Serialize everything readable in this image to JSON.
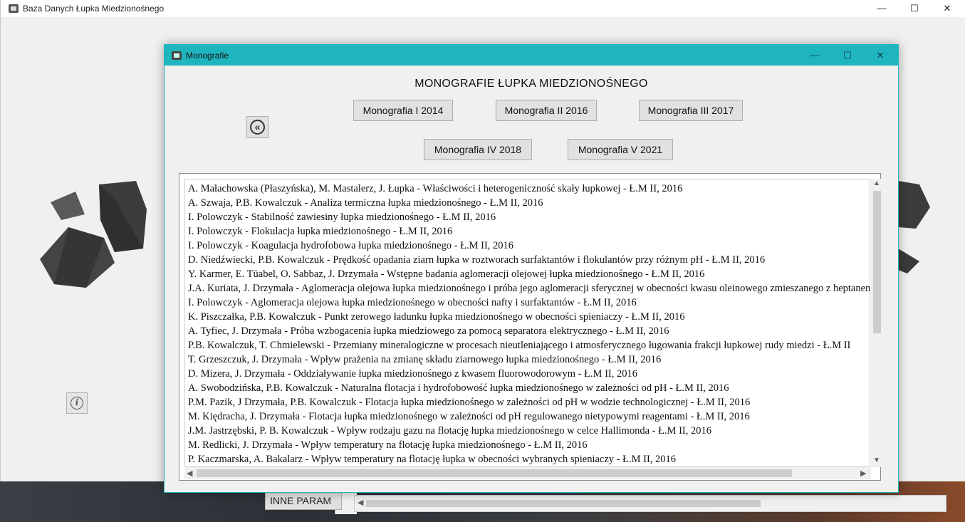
{
  "main_window": {
    "title": "Baza Danych Łupka Miedzionośnego",
    "minimize": "—",
    "maximize": "☐",
    "close": "✕",
    "inne_button_label": "INNE PARAM"
  },
  "dialog": {
    "title": "Monografie",
    "minimize": "—",
    "maximize": "☐",
    "close": "✕",
    "heading": "MONOGRAFIE ŁUPKA MIEDZIONOŚNEGO",
    "back_button_icon": "«",
    "info_icon": "i",
    "buttons": [
      "Monografia I 2014",
      "Monografia II 2016",
      "Monografia III 2017",
      "Monografia IV 2018",
      "Monografia V 2021"
    ],
    "list_items": [
      "A. Małachowska (Płaszyńska), M. Mastalerz, J. Łupka - Właściwości i heterogeniczność skały łupkowej - Ł.M II, 2016",
      "A. Szwaja, P.B. Kowalczuk - Analiza termiczna łupka miedzionośnego - Ł.M II, 2016",
      "I. Polowczyk - Stabilność zawiesiny łupka miedzionośnego - Ł.M II, 2016",
      "I. Polowczyk - Flokulacja łupka miedzionośnego - Ł.M II, 2016",
      "I. Polowczyk - Koagulacja hydrofobowa łupka miedzionośnego - Ł.M II, 2016",
      "D. Niedźwiecki, P.B. Kowalczuk - Prędkość opadania ziarn łupka w roztworach surfaktantów i flokulantów przy różnym pH - Ł.M II, 2016",
      "Y. Karmer, E. Tüabel, O. Sabbaz, J. Drzymała - Wstępne badania aglomeracji olejowej łupka miedzionośnego - Ł.M II, 2016",
      "J.A. Kuriata, J. Drzymała - Aglomeracja olejowa łupka miedzionośnego i próba jego aglomeracji sferycznej w obecności kwasu oleinowego zmieszanego z heptanem",
      "I. Polowczyk - Aglomeracja olejowa łupka miedzionośnego w obecności nafty i surfaktantów - Ł.M II, 2016",
      "K. Piszczałka, P.B. Kowalczuk - Punkt zerowego ładunku łupka miedzionośnego w obecności spieniaczy - Ł.M II, 2016",
      "A. Tyfiec, J. Drzymała - Próba wzbogacenia łupka miedziowego za pomocą separatora elektrycznego - Ł.M II, 2016",
      "P.B. Kowalczuk, T. Chmielewski - Przemiany mineralogiczne w procesach nieutleniającego i atmosferycznego ługowania frakcji łupkowej rudy miedzi - Ł.M II",
      "T. Grzeszczuk, J. Drzymała - Wpływ prażenia na zmianę składu ziarnowego łupka miedzionośnego - Ł.M II, 2016",
      "D. Mizera, J. Drzymała - Oddziaływanie łupka miedzionośnego z kwasem fluorowodorowym - Ł.M II, 2016",
      "A. Swobodzińska, P.B. Kowalczuk - Naturalna flotacja i hydrofobowość łupka miedzionośnego w zależności od pH - Ł.M II, 2016",
      "P.M. Pazik, J Drzymała, P.B. Kowalczuk - Flotacja łupka miedzionośnego w zależności od pH w wodzie technologicznej - Ł.M II, 2016",
      "M. Kiędracha, J. Drzymała - Flotacja łupka miedzionośnego w zależności od pH regulowanego nietypowymi reagentami - Ł.M II, 2016",
      "J.M. Jastrzębski, P. B. Kowalczuk - Wpływ rodzaju gazu na flotację łupka miedzionośnego w celce Hallimonda - Ł.M II, 2016",
      "M. Redlicki, J. Drzymała - Wpływ temperatury na flotację łupka miedzionośnego - Ł.M II, 2016",
      "P. Kaczmarska, A. Bakalarz - Wpływ temperatury na flotację łupka w obecności wybranych spieniaczy - Ł.M II, 2016"
    ]
  },
  "colors": {
    "dialog_accent": "#1fb5bf",
    "button_face": "#e1e1e1",
    "logo_dark": "#3c3c3c"
  }
}
